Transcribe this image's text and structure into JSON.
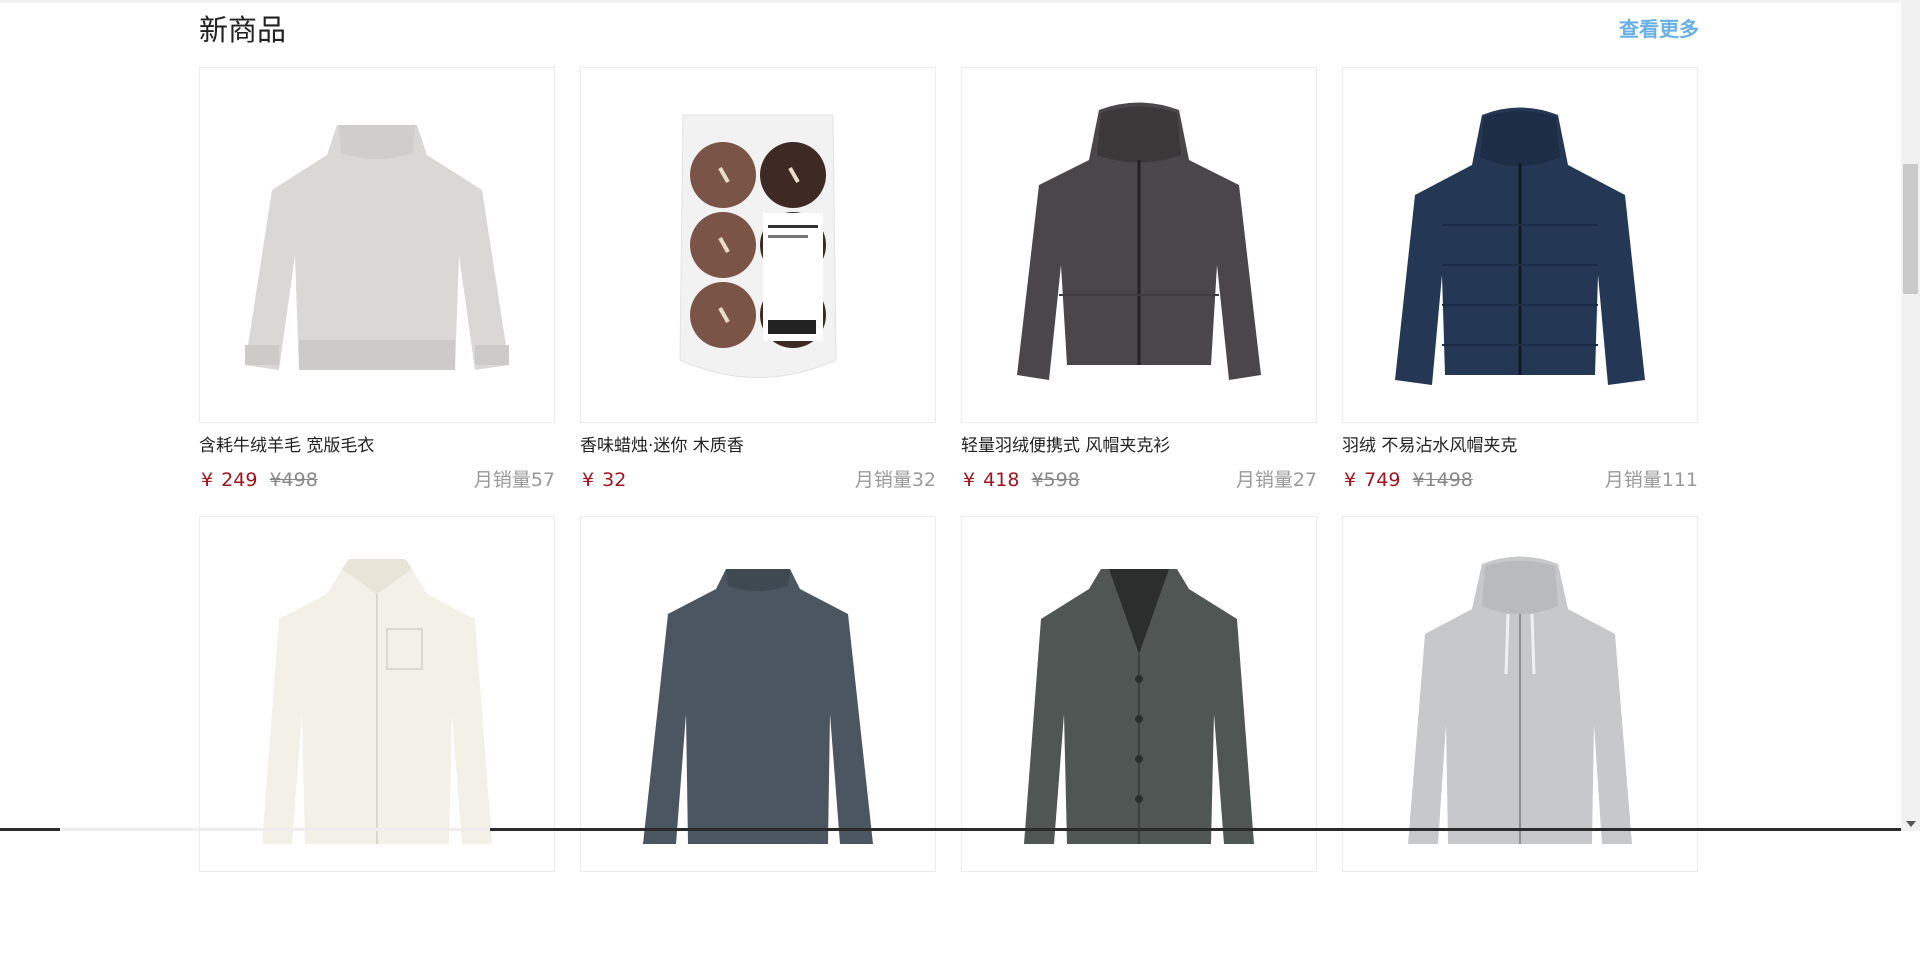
{
  "section": {
    "title": "新商品",
    "more_label": "查看更多"
  },
  "products": [
    {
      "name": "含耗牛绒羊毛 宽版毛衣",
      "currency": "¥",
      "price": "249",
      "old_price": "¥498",
      "sales": "月销量57",
      "icon": "sweater-image"
    },
    {
      "name": "香味蜡烛·迷你 木质香",
      "currency": "¥",
      "price": "32",
      "old_price": "",
      "sales": "月销量32",
      "icon": "candle-pack-image"
    },
    {
      "name": "轻量羽绒便携式 风帽夹克衫",
      "currency": "¥",
      "price": "418",
      "old_price": "¥598",
      "sales": "月销量27",
      "icon": "hooded-jacket-image"
    },
    {
      "name": "羽绒 不易沾水风帽夹克",
      "currency": "¥",
      "price": "749",
      "old_price": "¥1498",
      "sales": "月销量111",
      "icon": "down-jacket-image"
    },
    {
      "name": "",
      "currency": "",
      "price": "",
      "old_price": "",
      "sales": "",
      "icon": "white-shirt-image"
    },
    {
      "name": "",
      "currency": "",
      "price": "",
      "old_price": "",
      "sales": "",
      "icon": "mockneck-sweater-image"
    },
    {
      "name": "",
      "currency": "",
      "price": "",
      "old_price": "",
      "sales": "",
      "icon": "cardigan-image"
    },
    {
      "name": "",
      "currency": "",
      "price": "",
      "old_price": "",
      "sales": "",
      "icon": "zip-hoodie-image"
    }
  ],
  "colors": {
    "price": "#a0141e",
    "link": "#6ab0e8",
    "muted": "#999999"
  }
}
